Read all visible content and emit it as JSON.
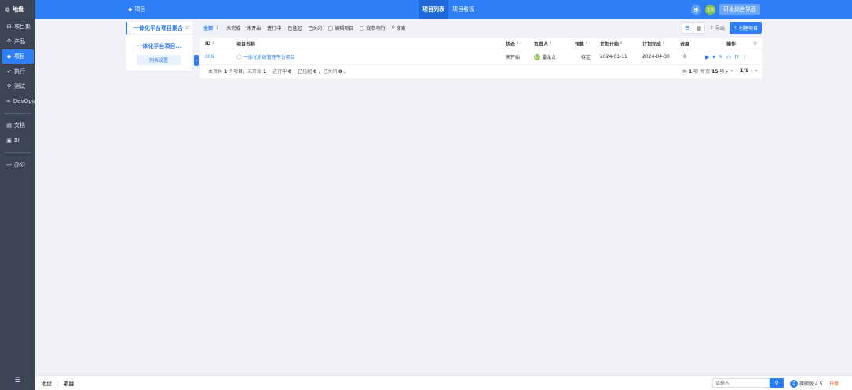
{
  "sidebar": {
    "logo": "地盘",
    "items": [
      {
        "label": "项目集",
        "icon": "grid-icon"
      },
      {
        "label": "产品",
        "icon": "pin-icon"
      },
      {
        "label": "项目",
        "icon": "shield-icon",
        "active": true
      },
      {
        "label": "执行",
        "icon": "run-icon"
      },
      {
        "label": "测试",
        "icon": "search-icon"
      },
      {
        "label": "DevOps",
        "icon": "infinity-icon"
      },
      {
        "label": "文档",
        "icon": "doc-icon"
      },
      {
        "label": "BI",
        "icon": "chart-icon"
      },
      {
        "label": "办公",
        "icon": "office-icon"
      }
    ],
    "menu_icon": "☰"
  },
  "header": {
    "crumb": "项目",
    "tabs": [
      "项目列表",
      "项目看板"
    ],
    "user_initials": "龙龙",
    "switch_label": "研发综合界面"
  },
  "set_panel": {
    "tab_label": "一体化平台项目集合",
    "item_label": "一体化平台项目...",
    "settings_btn": "列表设置"
  },
  "filters": {
    "all": "全部",
    "all_count": "1",
    "tabs": [
      "未完成",
      "未开始",
      "进行中",
      "已挂起",
      "已关闭"
    ],
    "edit_label": "编辑项目",
    "mine_label": "我参与的",
    "search_label": "搜索"
  },
  "actions": {
    "export": "导出",
    "create": "创建项目"
  },
  "table": {
    "headers": {
      "id": "ID",
      "name": "项目名称",
      "status": "状态",
      "owner": "负责人",
      "budget": "预算",
      "start": "计划开始",
      "end": "计划完成",
      "progress": "进度",
      "ops": "操作"
    },
    "rows": [
      {
        "id": "006",
        "name": "一体化系统管理平台项目",
        "status": "未开始",
        "owner": "潘龙龙",
        "owner_initials": "潘龙",
        "budget": "待定",
        "start": "2024-01-11",
        "end": "2024-04-30",
        "progress": "0"
      }
    ],
    "summary": {
      "t1": "本页共",
      "total": "1",
      "t2": "个项目，未开始",
      "notstarted": "1",
      "t3": "，进行中",
      "doing": "0",
      "t4": "，已挂起",
      "suspended": "0",
      "t5": "，已关闭",
      "closed": "0",
      "t6": "。"
    },
    "pager": {
      "t1": "共",
      "total": "1",
      "t2": "项",
      "t3": "每页",
      "per": "15",
      "t4": "项",
      "page": "1/1"
    }
  },
  "footer": {
    "crumb_home": "地盘",
    "crumb_current": "项目",
    "search_placeholder": "请输入",
    "version": "旗舰版 4.5",
    "upgrade": "升级"
  }
}
